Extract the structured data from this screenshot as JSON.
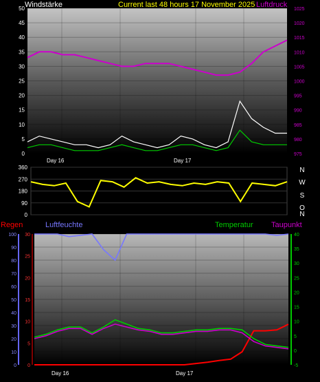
{
  "header": {
    "wind_title": "Windstärke",
    "center_title": "Current last 48 hours 17 November 2025",
    "pressure_title": "Luftdruck"
  },
  "lower_header": {
    "rain": "Regen",
    "humidity": "Luftfeuchte",
    "temperature": "Temperatur",
    "dewpoint": "Taupunkt"
  },
  "colors": {
    "background": "#000000",
    "wind": "#ffffff",
    "gust": "#00cc00",
    "pressure": "#cc00cc",
    "direction": "#ffff00",
    "rain": "#ff0000",
    "humidity": "#7777ff",
    "temperature": "#00cc00",
    "dewpoint": "#cc00cc",
    "title": "#ffff00"
  },
  "chart_data": [
    {
      "type": "line",
      "name": "wind-pressure",
      "x_ticks": [
        "Day 16",
        "Day 17"
      ],
      "left_axis": {
        "label": "Windstärke",
        "ticks": [
          0,
          5,
          10,
          15,
          20,
          25,
          30,
          35,
          40,
          45,
          50
        ],
        "ylim": [
          0,
          50
        ]
      },
      "right_axis": {
        "label": "Luftdruck",
        "ticks": [
          975,
          980,
          985,
          990,
          995,
          1000,
          1005,
          1010,
          1015,
          1020,
          1025
        ],
        "ylim": [
          975,
          1025
        ]
      },
      "series": [
        {
          "name": "Luftdruck",
          "axis": "right",
          "values": [
            1008,
            1010,
            1010,
            1009,
            1009,
            1008,
            1007,
            1006,
            1005,
            1005,
            1006,
            1006,
            1006,
            1005,
            1004,
            1003,
            1002,
            1002,
            1003,
            1006,
            1010,
            1012,
            1014
          ]
        },
        {
          "name": "Windstärke",
          "axis": "left",
          "values": [
            4,
            6,
            5,
            4,
            3,
            3,
            2,
            3,
            6,
            4,
            3,
            2,
            3,
            6,
            5,
            3,
            2,
            4,
            18,
            12,
            9,
            7,
            7
          ]
        },
        {
          "axis": "left",
          "values": [
            2,
            3,
            3,
            2,
            1,
            1,
            1,
            2,
            3,
            2,
            1,
            1,
            2,
            3,
            3,
            2,
            1,
            2,
            8,
            4,
            3,
            3,
            3
          ]
        }
      ]
    },
    {
      "type": "line",
      "name": "wind-direction",
      "left_axis": {
        "ticks": [
          0,
          90,
          180,
          270,
          360
        ],
        "ylim": [
          0,
          360
        ]
      },
      "right_axis": {
        "ticks": [
          "N",
          "W",
          "S",
          "O",
          "N"
        ]
      },
      "series": [
        {
          "axis": "left",
          "values": [
            250,
            230,
            220,
            240,
            100,
            60,
            260,
            250,
            210,
            280,
            240,
            250,
            230,
            220,
            240,
            230,
            250,
            240,
            100,
            240,
            230,
            220,
            250
          ]
        }
      ]
    },
    {
      "type": "line",
      "name": "rain-humidity-temperature",
      "x_ticks": [
        "Day 16",
        "Day 17"
      ],
      "left_axis_humidity": {
        "label": "Luftfeuchte",
        "ticks": [
          0,
          10,
          20,
          30,
          40,
          50,
          60,
          70,
          80,
          90,
          100
        ],
        "ylim": [
          0,
          100
        ]
      },
      "left_axis_rain": {
        "label": "Regen",
        "ticks": [
          0,
          5,
          10,
          15,
          20,
          25,
          30
        ],
        "ylim": [
          0,
          30
        ]
      },
      "right_axis": {
        "label": "Temperatur",
        "ticks": [
          -5,
          0,
          5,
          10,
          15,
          20,
          25,
          30,
          35,
          40
        ],
        "ylim": [
          -5,
          40
        ]
      },
      "series": [
        {
          "name": "Luftfeuchte",
          "axis": "humidity",
          "values": [
            100,
            100,
            100,
            98,
            99,
            100,
            88,
            80,
            100,
            100,
            100,
            100,
            100,
            100,
            100,
            100,
            100,
            100,
            100,
            100,
            100,
            99,
            100
          ]
        },
        {
          "name": "Regen",
          "axis": "rain",
          "values": [
            0,
            0,
            0,
            0,
            0,
            0,
            0,
            0,
            0,
            0,
            0,
            0,
            0,
            0,
            0.3,
            0.6,
            1.0,
            1.3,
            3.0,
            7.8,
            7.8,
            8.0,
            9.3
          ]
        },
        {
          "name": "Temperatur",
          "axis": "right",
          "values": [
            4.5,
            5.5,
            7,
            8,
            8,
            6,
            8,
            10.5,
            9,
            7.5,
            7,
            6,
            6,
            6.5,
            7,
            7,
            7.5,
            7.5,
            7,
            4,
            2,
            1.5,
            1
          ]
        },
        {
          "name": "Taupunkt",
          "axis": "right",
          "values": [
            4,
            5,
            6.5,
            7.5,
            7.5,
            5.5,
            7.5,
            9,
            8,
            7,
            6.5,
            5.5,
            5.5,
            6,
            6.5,
            6.5,
            7,
            7,
            6,
            3,
            1.5,
            1,
            0.5
          ]
        }
      ]
    }
  ]
}
